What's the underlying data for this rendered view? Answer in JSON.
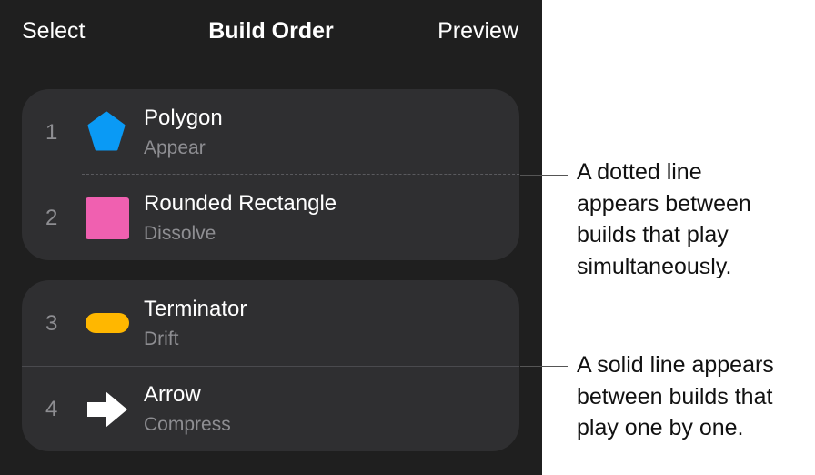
{
  "toolbar": {
    "select_label": "Select",
    "title": "Build Order",
    "preview_label": "Preview"
  },
  "groups": [
    {
      "separator": "dotted",
      "items": [
        {
          "number": "1",
          "name": "Polygon",
          "effect": "Appear",
          "icon": "pentagon-icon",
          "icon_color": "#0a9af5"
        },
        {
          "number": "2",
          "name": "Rounded Rectangle",
          "effect": "Dissolve",
          "icon": "square-icon",
          "icon_color": "#f060b0"
        }
      ]
    },
    {
      "separator": "solid",
      "items": [
        {
          "number": "3",
          "name": "Terminator",
          "effect": "Drift",
          "icon": "terminator-pill-icon",
          "icon_color": "#ffb700"
        },
        {
          "number": "4",
          "name": "Arrow",
          "effect": "Compress",
          "icon": "arrow-right-icon",
          "icon_color": "#ffffff"
        }
      ]
    }
  ],
  "callouts": [
    {
      "lines": [
        "A dotted line",
        "appears between",
        "builds that play",
        "simultaneously."
      ]
    },
    {
      "lines": [
        "A solid line appears",
        "between builds that",
        "play one by one."
      ]
    }
  ],
  "colors": {
    "panel_background": "#1f1f1f",
    "group_background": "#2f2f31",
    "primary_text": "#ffffff",
    "secondary_text": "#8e8e92"
  }
}
